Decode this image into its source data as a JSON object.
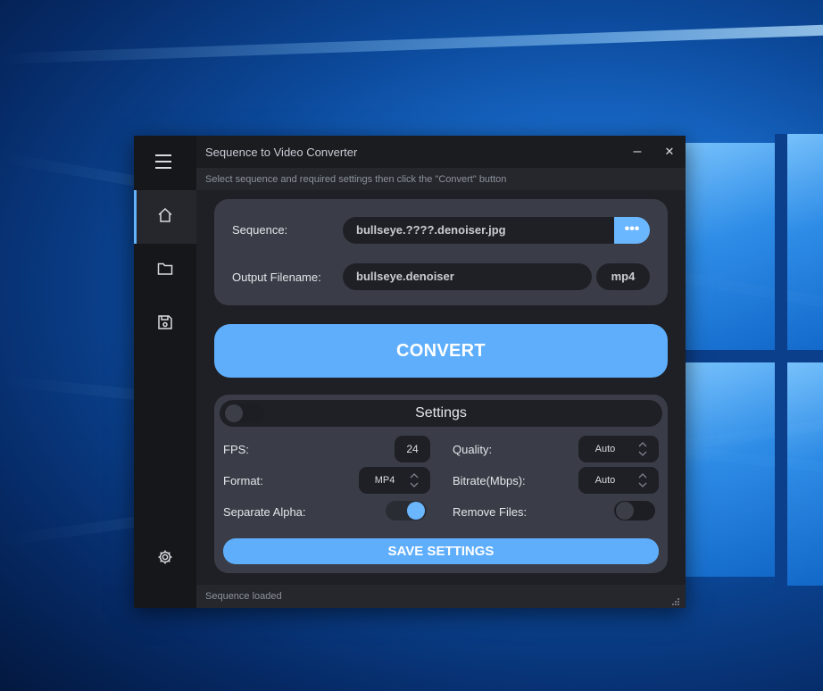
{
  "window": {
    "title": "Sequence to Video Converter",
    "subtitle": "Select sequence and required settings then click the \"Convert\" button",
    "minimize_label": "–",
    "close_label": "✕"
  },
  "sidebar": {
    "items": [
      {
        "icon": "home-icon",
        "active": true
      },
      {
        "icon": "folder-icon",
        "active": false
      },
      {
        "icon": "save-icon",
        "active": false
      },
      {
        "icon": "gear-icon",
        "active": false
      }
    ]
  },
  "input": {
    "sequence_label": "Sequence:",
    "sequence_value": "bullseye.????.denoiser.jpg",
    "browse_label": "•••",
    "output_label": "Output Filename:",
    "output_value": "bullseye.denoiser",
    "extension": "mp4"
  },
  "convert_label": "CONVERT",
  "settings": {
    "title": "Settings",
    "expanded_toggle": false,
    "fps_label": "FPS:",
    "fps_value": "24",
    "quality_label": "Quality:",
    "quality_value": "Auto",
    "format_label": "Format:",
    "format_value": "MP4",
    "bitrate_label": "Bitrate(Mbps):",
    "bitrate_value": "Auto",
    "separate_alpha_label": "Separate Alpha:",
    "separate_alpha": true,
    "remove_files_label": "Remove Files:",
    "remove_files": false,
    "save_label": "SAVE SETTINGS"
  },
  "status": "Sequence loaded",
  "colors": {
    "accent": "#5eaefc",
    "window_bg": "#1e2025",
    "panel_bg": "#3a3d47"
  }
}
